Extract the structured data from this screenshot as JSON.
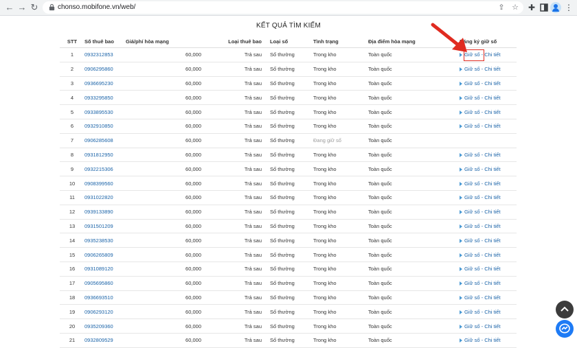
{
  "browser": {
    "url": "chonso.mobifone.vn/web/",
    "back_glyph": "←",
    "forward_glyph": "→",
    "reload_glyph": "↻",
    "icons": [
      "lock-icon",
      "share-icon",
      "star-icon",
      "extension-icon",
      "sidebar-icon",
      "profile-icon",
      "menu-icon"
    ]
  },
  "page": {
    "title": "KẾT QUẢ TÌM KIẾM",
    "columns": [
      "STT",
      "Số thuê bao",
      "Giá/phí hòa mạng",
      "Loại thuê bao",
      "Loại số",
      "Tình trạng",
      "Địa điểm hòa mạng",
      "Đăng ký giữ số"
    ],
    "action_hold": "Giữ số",
    "action_sep": " - ",
    "action_detail": "Chi tiết",
    "rows": [
      {
        "stt": "1",
        "number": "0932312853",
        "fee": "60,000",
        "sub_type": "Trả sau",
        "num_type": "Số thường",
        "status": "Trong kho",
        "location": "Toàn quốc",
        "has_actions": true
      },
      {
        "stt": "2",
        "number": "0906295860",
        "fee": "60,000",
        "sub_type": "Trả sau",
        "num_type": "Số thường",
        "status": "Trong kho",
        "location": "Toàn quốc",
        "has_actions": true
      },
      {
        "stt": "3",
        "number": "0936695230",
        "fee": "60,000",
        "sub_type": "Trả sau",
        "num_type": "Số thường",
        "status": "Trong kho",
        "location": "Toàn quốc",
        "has_actions": true
      },
      {
        "stt": "4",
        "number": "0933295850",
        "fee": "60,000",
        "sub_type": "Trả sau",
        "num_type": "Số thường",
        "status": "Trong kho",
        "location": "Toàn quốc",
        "has_actions": true
      },
      {
        "stt": "5",
        "number": "0933895530",
        "fee": "60,000",
        "sub_type": "Trả sau",
        "num_type": "Số thường",
        "status": "Trong kho",
        "location": "Toàn quốc",
        "has_actions": true
      },
      {
        "stt": "6",
        "number": "0932910850",
        "fee": "60,000",
        "sub_type": "Trả sau",
        "num_type": "Số thường",
        "status": "Trong kho",
        "location": "Toàn quốc",
        "has_actions": true
      },
      {
        "stt": "7",
        "number": "0906285608",
        "fee": "60,000",
        "sub_type": "Trả sau",
        "num_type": "Số thường",
        "status": "Đang giữ số",
        "location": "Toàn quốc",
        "has_actions": false
      },
      {
        "stt": "8",
        "number": "0931812950",
        "fee": "60,000",
        "sub_type": "Trả sau",
        "num_type": "Số thường",
        "status": "Trong kho",
        "location": "Toàn quốc",
        "has_actions": true
      },
      {
        "stt": "9",
        "number": "0932215306",
        "fee": "60,000",
        "sub_type": "Trả sau",
        "num_type": "Số thường",
        "status": "Trong kho",
        "location": "Toàn quốc",
        "has_actions": true
      },
      {
        "stt": "10",
        "number": "0908399560",
        "fee": "60,000",
        "sub_type": "Trả sau",
        "num_type": "Số thường",
        "status": "Trong kho",
        "location": "Toàn quốc",
        "has_actions": true
      },
      {
        "stt": "11",
        "number": "0931022820",
        "fee": "60,000",
        "sub_type": "Trả sau",
        "num_type": "Số thường",
        "status": "Trong kho",
        "location": "Toàn quốc",
        "has_actions": true
      },
      {
        "stt": "12",
        "number": "0939133890",
        "fee": "60,000",
        "sub_type": "Trả sau",
        "num_type": "Số thường",
        "status": "Trong kho",
        "location": "Toàn quốc",
        "has_actions": true
      },
      {
        "stt": "13",
        "number": "0931501209",
        "fee": "60,000",
        "sub_type": "Trả sau",
        "num_type": "Số thường",
        "status": "Trong kho",
        "location": "Toàn quốc",
        "has_actions": true
      },
      {
        "stt": "14",
        "number": "0935238530",
        "fee": "60,000",
        "sub_type": "Trả sau",
        "num_type": "Số thường",
        "status": "Trong kho",
        "location": "Toàn quốc",
        "has_actions": true
      },
      {
        "stt": "15",
        "number": "0906265809",
        "fee": "60,000",
        "sub_type": "Trả sau",
        "num_type": "Số thường",
        "status": "Trong kho",
        "location": "Toàn quốc",
        "has_actions": true
      },
      {
        "stt": "16",
        "number": "0931089120",
        "fee": "60,000",
        "sub_type": "Trả sau",
        "num_type": "Số thường",
        "status": "Trong kho",
        "location": "Toàn quốc",
        "has_actions": true
      },
      {
        "stt": "17",
        "number": "0905695860",
        "fee": "60,000",
        "sub_type": "Trả sau",
        "num_type": "Số thường",
        "status": "Trong kho",
        "location": "Toàn quốc",
        "has_actions": true
      },
      {
        "stt": "18",
        "number": "0936693510",
        "fee": "60,000",
        "sub_type": "Trả sau",
        "num_type": "Số thường",
        "status": "Trong kho",
        "location": "Toàn quốc",
        "has_actions": true
      },
      {
        "stt": "19",
        "number": "0906293120",
        "fee": "60,000",
        "sub_type": "Trả sau",
        "num_type": "Số thường",
        "status": "Trong kho",
        "location": "Toàn quốc",
        "has_actions": true
      },
      {
        "stt": "20",
        "number": "0935209360",
        "fee": "60,000",
        "sub_type": "Trả sau",
        "num_type": "Số thường",
        "status": "Trong kho",
        "location": "Toàn quốc",
        "has_actions": true
      },
      {
        "stt": "21",
        "number": "0932809529",
        "fee": "60,000",
        "sub_type": "Trả sau",
        "num_type": "Số thường",
        "status": "Trong kho",
        "location": "Toàn quốc",
        "has_actions": true
      }
    ]
  },
  "annotation": {
    "color": "#e02b20",
    "target": "Giữ số",
    "icons": [
      "red-arrow-icon",
      "highlight-box"
    ]
  },
  "floating": {
    "icons": [
      "chevron-up-icon",
      "messenger-icon"
    ]
  },
  "colors": {
    "link": "#1a63a8",
    "muted": "#9a9a9a",
    "annotation": "#e02b20",
    "messenger": "#1e7bf5"
  }
}
